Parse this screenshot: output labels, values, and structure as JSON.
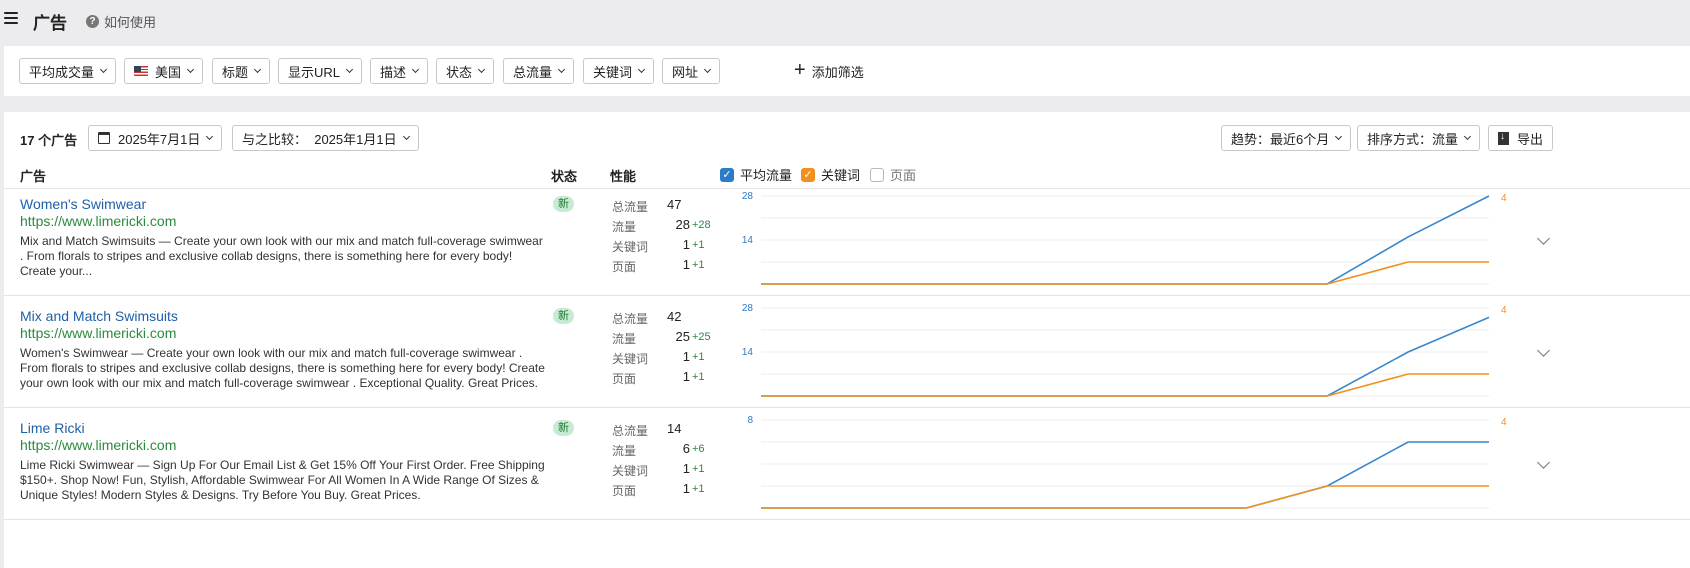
{
  "header": {
    "title": "广告",
    "help": "如何使用"
  },
  "filters": {
    "items": [
      {
        "label": "平均成交量"
      },
      {
        "label": "美国",
        "flag": "us-flag-icon"
      },
      {
        "label": "标题"
      },
      {
        "label": "显示URL"
      },
      {
        "label": "描述"
      },
      {
        "label": "状态"
      },
      {
        "label": "总流量"
      },
      {
        "label": "关键词"
      },
      {
        "label": "网址"
      }
    ],
    "add": "添加筛选"
  },
  "toolbar": {
    "count": "17 个广告",
    "date": "2025年7月1日",
    "compare": "与之比较：  2025年1月1日",
    "trend": "趋势：最近6个月",
    "sort": "排序方式：流量",
    "export": "导出"
  },
  "table": {
    "headers": {
      "ad": "广告",
      "status": "状态",
      "performance": "性能"
    },
    "legend": [
      {
        "label": "平均流量",
        "checked": true,
        "color": "#2b7bc8"
      },
      {
        "label": "关键词",
        "checked": true,
        "color": "#f0901e"
      },
      {
        "label": "页面",
        "checked": false,
        "color": "#b8b8bc"
      }
    ],
    "metric_labels": [
      "总流量",
      "流量",
      "关键词",
      "页面"
    ],
    "rows": [
      {
        "title": "Women's Swimwear",
        "url": "https://www.limericki.com",
        "desc": "Mix and Match Swimsuits — Create your own look with our mix and match full-coverage swimwear . From florals to stripes and exclusive collab designs, there is something here for every body! Create your...",
        "status": "新",
        "total": "47",
        "traffic": "28",
        "traffic_delta": "+28",
        "keywords": "1",
        "keywords_delta": "+1",
        "pages": "1",
        "pages_delta": "+1",
        "chart": {
          "y_max_label": "28",
          "y_mid_label": "14",
          "right_label": "4",
          "ymax": 28,
          "rmax": 4,
          "traffic": [
            0,
            0,
            0,
            0,
            0,
            0,
            0,
            0,
            15,
            28
          ],
          "keywords": [
            0,
            0,
            0,
            0,
            0,
            0,
            0,
            0,
            1,
            1
          ]
        }
      },
      {
        "title": "Mix and Match Swimsuits",
        "url": "https://www.limericki.com",
        "desc": "Women's Swimwear — Create your own look with our mix and match full-coverage swimwear . From florals to stripes and exclusive collab designs, there is something here for every body! Create your own look with our mix and match full-coverage swimwear . Exceptional Quality. Great Prices.",
        "status": "新",
        "total": "42",
        "traffic": "25",
        "traffic_delta": "+25",
        "keywords": "1",
        "keywords_delta": "+1",
        "pages": "1",
        "pages_delta": "+1",
        "chart": {
          "y_max_label": "28",
          "y_mid_label": "14",
          "right_label": "4",
          "ymax": 28,
          "rmax": 4,
          "traffic": [
            0,
            0,
            0,
            0,
            0,
            0,
            0,
            0,
            14,
            25
          ],
          "keywords": [
            0,
            0,
            0,
            0,
            0,
            0,
            0,
            0,
            1,
            1
          ]
        }
      },
      {
        "title": "Lime Ricki",
        "url": "https://www.limericki.com",
        "desc": "Lime Ricki Swimwear — Sign Up For Our Email List & Get 15% Off Your First Order. Free Shipping $150+. Shop Now! Fun, Stylish, Affordable Swimwear For All Women In A Wide Range Of Sizes & Unique Styles! Modern Styles & Designs. Try Before You Buy. Great Prices.",
        "status": "新",
        "total": "14",
        "traffic": "6",
        "traffic_delta": "+6",
        "keywords": "1",
        "keywords_delta": "+1",
        "pages": "1",
        "pages_delta": "+1",
        "chart": {
          "y_max_label": "8",
          "y_mid_label": "",
          "right_label": "4",
          "ymax": 8,
          "rmax": 4,
          "traffic": [
            0,
            0,
            0,
            0,
            0,
            0,
            0,
            2,
            6,
            6
          ],
          "keywords": [
            0,
            0,
            0,
            0,
            0,
            0,
            0,
            1,
            1,
            1
          ]
        }
      }
    ]
  }
}
